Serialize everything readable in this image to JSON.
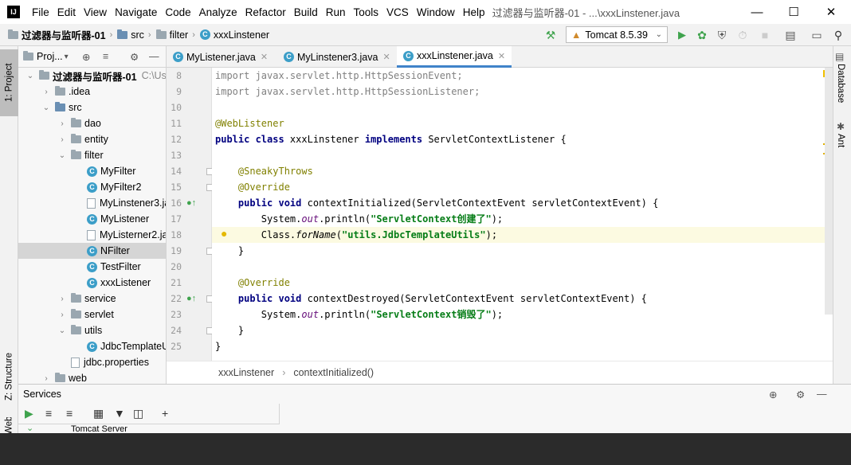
{
  "window": {
    "logo": "IJ",
    "title": "过滤器与监听器-01 - ...\\xxxLinstener.java"
  },
  "menu": [
    "File",
    "Edit",
    "View",
    "Navigate",
    "Code",
    "Analyze",
    "Refactor",
    "Build",
    "Run",
    "Tools",
    "VCS",
    "Window",
    "Help"
  ],
  "breadcrumbs": [
    "过滤器与监听器-01",
    "src",
    "filter",
    "xxxLinstener"
  ],
  "run_config": {
    "label": "Tomcat 8.5.39"
  },
  "left_tabs": {
    "project": "1: Project",
    "structure": "Z: Structure",
    "web": "Web"
  },
  "right_tabs": {
    "database": "Database",
    "ant": "Ant"
  },
  "project_panel": {
    "title": "Proj...",
    "root": "过滤器与监听器-01",
    "root_path": "C:\\Users\\",
    "tree": [
      {
        "label": ".idea",
        "depth": 1,
        "kind": "folder",
        "arrow": "›"
      },
      {
        "label": "src",
        "depth": 1,
        "kind": "folder-blue",
        "arrow": "⌄"
      },
      {
        "label": "dao",
        "depth": 2,
        "kind": "folder",
        "arrow": "›"
      },
      {
        "label": "entity",
        "depth": 2,
        "kind": "folder",
        "arrow": "›"
      },
      {
        "label": "filter",
        "depth": 2,
        "kind": "folder",
        "arrow": "⌄"
      },
      {
        "label": "MyFilter",
        "depth": 3,
        "kind": "class"
      },
      {
        "label": "MyFilter2",
        "depth": 3,
        "kind": "class"
      },
      {
        "label": "MyLinstener3.java",
        "depth": 3,
        "kind": "file"
      },
      {
        "label": "MyListener",
        "depth": 3,
        "kind": "class"
      },
      {
        "label": "MyListerner2.java",
        "depth": 3,
        "kind": "file"
      },
      {
        "label": "NFilter",
        "depth": 3,
        "kind": "class",
        "selected": true
      },
      {
        "label": "TestFilter",
        "depth": 3,
        "kind": "class"
      },
      {
        "label": "xxxListener",
        "depth": 3,
        "kind": "class"
      },
      {
        "label": "service",
        "depth": 2,
        "kind": "folder",
        "arrow": "›"
      },
      {
        "label": "servlet",
        "depth": 2,
        "kind": "folder",
        "arrow": "›"
      },
      {
        "label": "utils",
        "depth": 2,
        "kind": "folder",
        "arrow": "⌄"
      },
      {
        "label": "JdbcTemplateUtil",
        "depth": 3,
        "kind": "class"
      },
      {
        "label": "jdbc.properties",
        "depth": 2,
        "kind": "file"
      },
      {
        "label": "web",
        "depth": 1,
        "kind": "folder",
        "arrow": "›"
      }
    ]
  },
  "tabs": [
    {
      "label": "MyListener.java",
      "active": false
    },
    {
      "label": "MyLinstener3.java",
      "active": false
    },
    {
      "label": "xxxLinstener.java",
      "active": true
    }
  ],
  "code_lines": [
    {
      "n": "8",
      "html": "<span class=\"gray\">import javax.servlet.http.HttpSessionEvent;</span>"
    },
    {
      "n": "9",
      "html": "<span class=\"gray\">import javax.servlet.http.HttpSessionListener;</span>"
    },
    {
      "n": "10",
      "html": ""
    },
    {
      "n": "11",
      "html": "<span class=\"an\">@WebListener</span>"
    },
    {
      "n": "12",
      "html": "<span class=\"kw\">public class</span> xxxLinstener <span class=\"kw\">implements</span> ServletContextListener {"
    },
    {
      "n": "13",
      "html": ""
    },
    {
      "n": "14",
      "html": "    <span class=\"an\">@SneakyThrows</span>"
    },
    {
      "n": "15",
      "html": "    <span class=\"an\">@Override</span>"
    },
    {
      "n": "16",
      "html": "    <span class=\"kw\">public void</span> contextInitialized(ServletContextEvent servletContextEvent) {"
    },
    {
      "n": "17",
      "html": "        System.<span class=\"it\">out</span>.println(<span class=\"str\">\"ServletContext创建了\"</span>);"
    },
    {
      "n": "18",
      "html": "        Class.<i>forName</i>(<span class=\"str\">\"utils.JdbcTemplateUtils\"</span>);"
    },
    {
      "n": "19",
      "html": "    }"
    },
    {
      "n": "20",
      "html": ""
    },
    {
      "n": "21",
      "html": "    <span class=\"an\">@Override</span>"
    },
    {
      "n": "22",
      "html": "    <span class=\"kw\">public void</span> contextDestroyed(ServletContextEvent servletContextEvent) {"
    },
    {
      "n": "23",
      "html": "        System.<span class=\"it\">out</span>.println(<span class=\"str\">\"ServletContext销毁了\"</span>);"
    },
    {
      "n": "24",
      "html": "    }"
    },
    {
      "n": "25",
      "html": "}"
    }
  ],
  "editor_breadcrumb": [
    "xxxLinstener",
    "contextInitialized()"
  ],
  "services": {
    "title": "Services",
    "tree_item": "Tomcat Server"
  },
  "colors": {
    "accent": "#4083c9",
    "run_green": "#3fa34d",
    "current_line": "#fcfae1"
  }
}
